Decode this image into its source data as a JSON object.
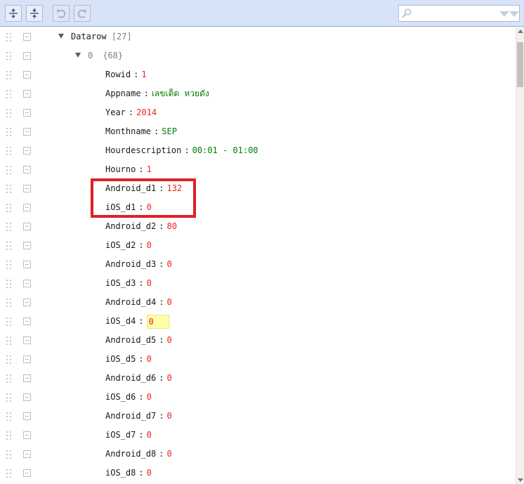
{
  "toolbar": {
    "buttons": [
      {
        "name": "expand-all-button",
        "icon": "expand-all-icon",
        "enabled": true
      },
      {
        "name": "collapse-all-button",
        "icon": "collapse-all-icon",
        "enabled": true
      },
      {
        "name": "undo-button",
        "icon": "undo-icon",
        "enabled": false
      },
      {
        "name": "redo-button",
        "icon": "redo-icon",
        "enabled": false
      }
    ],
    "search": {
      "value": "",
      "placeholder": "",
      "icon": "search-icon"
    }
  },
  "colors": {
    "number": "#ee2222",
    "string": "#008000",
    "meta": "#808080",
    "highlight_box": "#e01f26",
    "toolbar_bg": "#d7e3f8"
  },
  "tree": {
    "root": {
      "key": "Datarow",
      "count": "[27]"
    },
    "item": {
      "index": "0",
      "count": "{68}"
    },
    "fields": [
      {
        "key": "Rowid",
        "value": "1",
        "type": "number"
      },
      {
        "key": "Appname",
        "value": "เลขเด็ด หวยดัง",
        "type": "string"
      },
      {
        "key": "Year",
        "value": "2014",
        "type": "number"
      },
      {
        "key": "Monthname",
        "value": "SEP",
        "type": "string"
      },
      {
        "key": "Hourdescription",
        "value": "00:01 - 01:00",
        "type": "string"
      },
      {
        "key": "Hourno",
        "value": "1",
        "type": "number"
      },
      {
        "key": "Android_d1",
        "value": "132",
        "type": "number"
      },
      {
        "key": "iOS_d1",
        "value": "0",
        "type": "number"
      },
      {
        "key": "Android_d2",
        "value": "80",
        "type": "number"
      },
      {
        "key": "iOS_d2",
        "value": "0",
        "type": "number"
      },
      {
        "key": "Android_d3",
        "value": "0",
        "type": "number"
      },
      {
        "key": "iOS_d3",
        "value": "0",
        "type": "number"
      },
      {
        "key": "Android_d4",
        "value": "0",
        "type": "number"
      },
      {
        "key": "iOS_d4",
        "value": "0",
        "type": "number",
        "editing": true
      },
      {
        "key": "Android_d5",
        "value": "0",
        "type": "number"
      },
      {
        "key": "iOS_d5",
        "value": "0",
        "type": "number"
      },
      {
        "key": "Android_d6",
        "value": "0",
        "type": "number"
      },
      {
        "key": "iOS_d6",
        "value": "0",
        "type": "number"
      },
      {
        "key": "Android_d7",
        "value": "0",
        "type": "number"
      },
      {
        "key": "iOS_d7",
        "value": "0",
        "type": "number"
      },
      {
        "key": "Android_d8",
        "value": "0",
        "type": "number"
      },
      {
        "key": "iOS_d8",
        "value": "0",
        "type": "number"
      }
    ]
  }
}
